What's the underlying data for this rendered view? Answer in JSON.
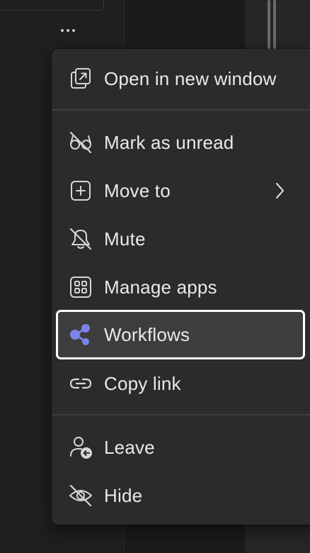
{
  "background": {
    "more_label": "More options"
  },
  "menu": {
    "items": [
      {
        "label": "Open in new window",
        "icon": "open-in-new-window-icon"
      },
      {
        "label": "Mark as unread",
        "icon": "glasses-slash-icon"
      },
      {
        "label": "Move to",
        "icon": "plus-square-icon",
        "has_submenu": true
      },
      {
        "label": "Mute",
        "icon": "bell-slash-icon"
      },
      {
        "label": "Manage apps",
        "icon": "apps-grid-icon"
      },
      {
        "label": "Workflows",
        "icon": "workflows-icon",
        "selected": true
      },
      {
        "label": "Copy link",
        "icon": "link-icon"
      },
      {
        "label": "Leave",
        "icon": "person-leave-icon"
      },
      {
        "label": "Hide",
        "icon": "eye-slash-icon"
      }
    ]
  },
  "colors": {
    "menu_bg": "#2b2b2b",
    "selected_bg": "#3d3d3d",
    "selected_border": "#ffffff",
    "workflows_accent": "#7b83eb",
    "text": "#e9e9e9"
  }
}
